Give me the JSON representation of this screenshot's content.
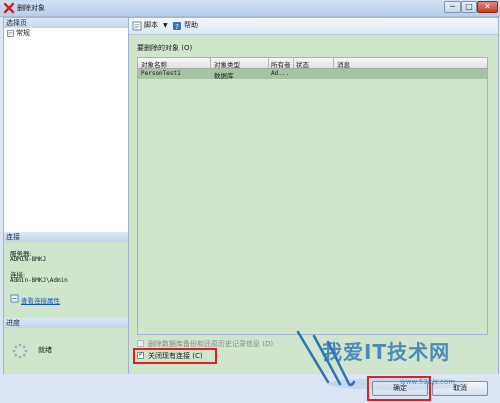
{
  "window": {
    "title": "删除对象",
    "minimize": "─",
    "maximize": "□",
    "close": "✕"
  },
  "left": {
    "pages_header": "选择页",
    "pages": [
      {
        "label": "常规"
      }
    ],
    "connection_header": "连接",
    "server_label": "服务器:",
    "server_value": "ADMIN-BMKJ",
    "connection_label": "连接:",
    "connection_value": "Admin-BMKJ\\Admin",
    "view_connection_link": "查看连接属性",
    "progress_header": "进度",
    "progress_status": "就绪"
  },
  "toolbar": {
    "script_label": "脚本",
    "help_label": "帮助"
  },
  "main": {
    "objects_label": "要删除的对象 (O)",
    "columns": [
      "对象名称",
      "对象类型",
      "所有者",
      "状态",
      "消息"
    ],
    "rows": [
      {
        "name": "PersonTest1",
        "type": "数据库",
        "owner": "Ad...",
        "status": "",
        "message": ""
      }
    ],
    "delete_backup_label": "删除数据库备份和还原历史记录信息 (D)",
    "close_connections_label": "关闭现有连接 (C)"
  },
  "buttons": {
    "ok": "确定",
    "cancel": "取消"
  },
  "watermark": {
    "text": "我爱IT技术网",
    "url": "www.52itjs.com"
  },
  "colors": {
    "panel_green": "#cfe6cd",
    "selected_row": "#a7c3a6",
    "highlight": "#e02020",
    "link": "#1a55b8"
  },
  "states": {
    "close_connections_checked": true,
    "delete_backup_checked": false
  }
}
